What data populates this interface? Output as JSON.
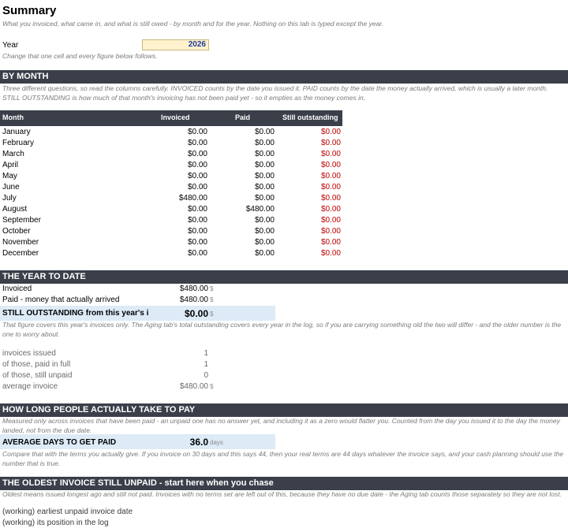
{
  "title": "Summary",
  "subtitle": "What you invoiced, what came in, and what is still owed - by month and for the year. Nothing on this tab is typed except the year.",
  "year": {
    "label": "Year",
    "value": "2026",
    "hint": "Change that one cell and every figure below follows."
  },
  "by_month": {
    "heading": "BY MONTH",
    "note": "Three different questions, so read the columns carefully. INVOICED counts by the date you issued it. PAID counts by the date the money actually arrived, which is usually a later month. STILL OUTSTANDING is how much of that month's invoicing has not been paid yet - so it empties as the money comes in.",
    "columns": [
      "Month",
      "Invoiced",
      "Paid",
      "Still outstanding"
    ],
    "rows": [
      [
        "January",
        "$0.00",
        "$0.00",
        "$0.00"
      ],
      [
        "February",
        "$0.00",
        "$0.00",
        "$0.00"
      ],
      [
        "March",
        "$0.00",
        "$0.00",
        "$0.00"
      ],
      [
        "April",
        "$0.00",
        "$0.00",
        "$0.00"
      ],
      [
        "May",
        "$0.00",
        "$0.00",
        "$0.00"
      ],
      [
        "June",
        "$0.00",
        "$0.00",
        "$0.00"
      ],
      [
        "July",
        "$480.00",
        "$0.00",
        "$0.00"
      ],
      [
        "August",
        "$0.00",
        "$480.00",
        "$0.00"
      ],
      [
        "September",
        "$0.00",
        "$0.00",
        "$0.00"
      ],
      [
        "October",
        "$0.00",
        "$0.00",
        "$0.00"
      ],
      [
        "November",
        "$0.00",
        "$0.00",
        "$0.00"
      ],
      [
        "December",
        "$0.00",
        "$0.00",
        "$0.00"
      ]
    ]
  },
  "ytd": {
    "heading": "THE YEAR TO DATE",
    "invoiced_label": "Invoiced",
    "invoiced_value": "$480.00",
    "paid_label": "Paid - money that actually arrived",
    "paid_value": "$480.00",
    "unit": "$",
    "outstanding_label": "STILL OUTSTANDING from this year's i",
    "outstanding_value": "$0.00",
    "note": "That figure covers this year's invoices only. The Aging tab's total outstanding covers every year in the log, so if you are carrying something old the two will differ - and the older number is the one to worry about.",
    "stats": [
      {
        "label": "invoices issued",
        "value": "1",
        "unit": ""
      },
      {
        "label": "of those, paid in full",
        "value": "1",
        "unit": ""
      },
      {
        "label": "of those, still unpaid",
        "value": "0",
        "unit": ""
      },
      {
        "label": "average invoice",
        "value": "$480.00",
        "unit": "$"
      }
    ]
  },
  "pay_time": {
    "heading": "HOW LONG PEOPLE ACTUALLY TAKE TO PAY",
    "note": "Measured only across invoices that have been paid - an unpaid one has no answer yet, and including it as a zero would flatter you. Counted from the day you issued it to the day the money landed, not from the due date.",
    "label": "AVERAGE DAYS TO GET PAID",
    "value": "36.0",
    "unit": "days",
    "note2": "Compare that with the terms you actually give. If you invoice on 30 days and this says 44, then your real terms are 44 days whatever the invoice says, and your cash planning should use the number that is true."
  },
  "oldest": {
    "heading": "THE OLDEST INVOICE STILL UNPAID - start here when you chase",
    "note": "Oldest means issued longest ago and still not paid. Invoices with no terms set are left out of this, because they have no due date - the Aging tab counts those separately so they are not lost.",
    "working1": "(working) earliest unpaid invoice date",
    "working2": "(working) its position in the log"
  }
}
